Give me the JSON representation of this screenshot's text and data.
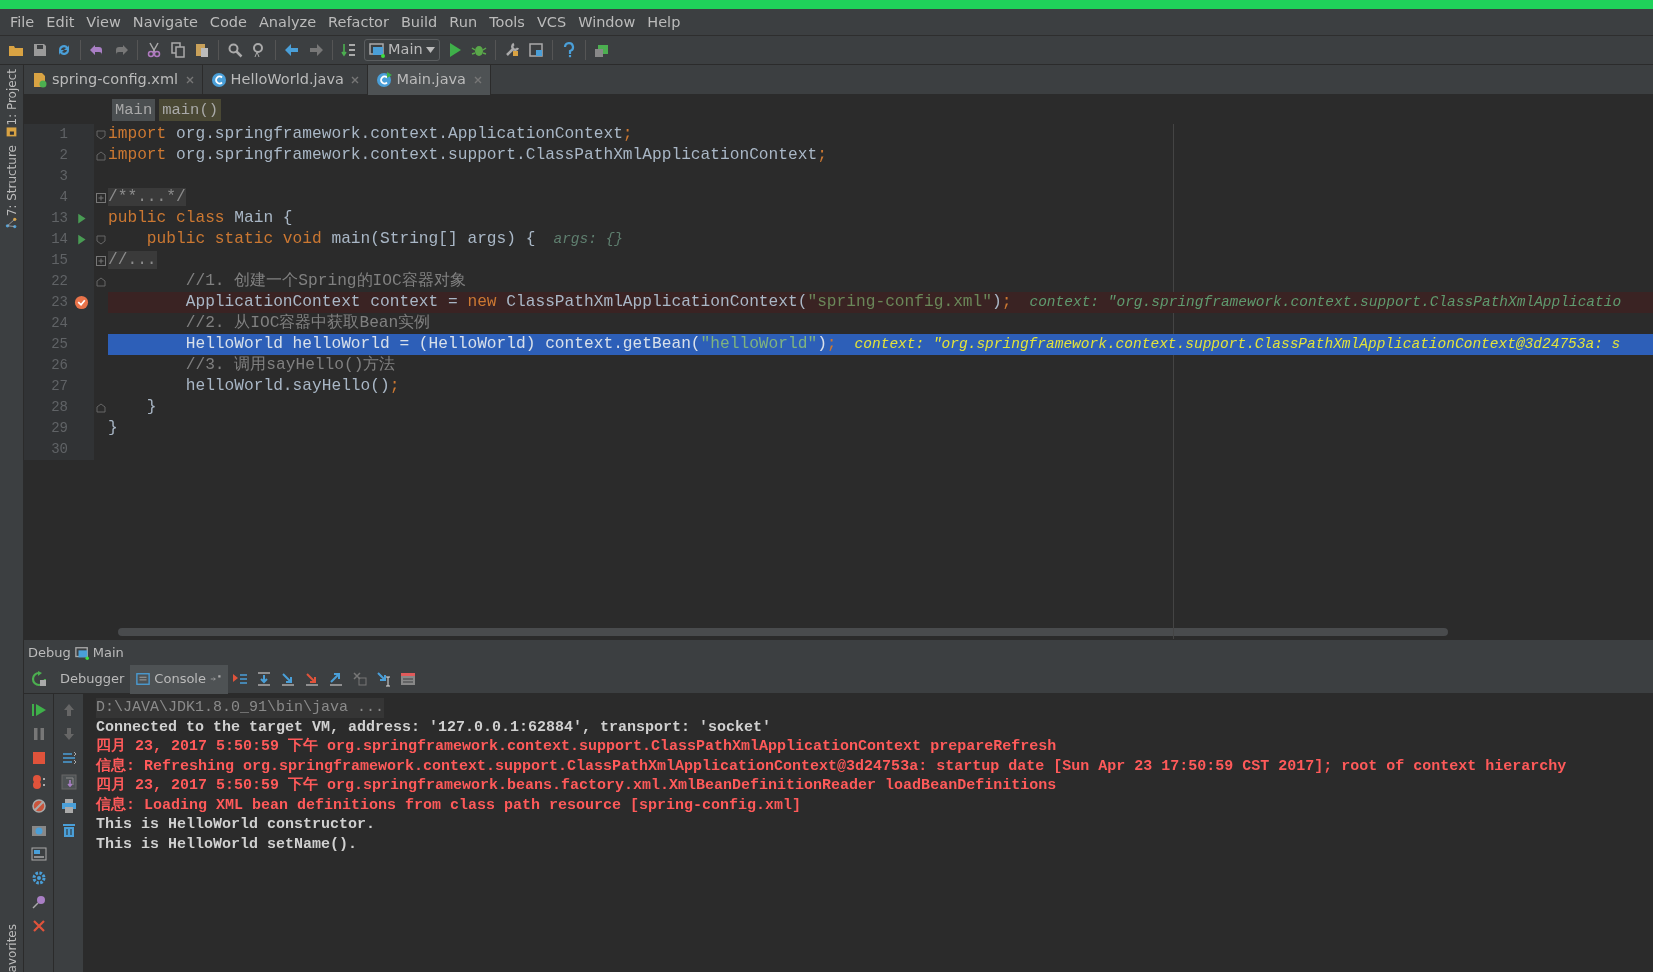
{
  "menu": [
    "File",
    "Edit",
    "View",
    "Navigate",
    "Code",
    "Analyze",
    "Refactor",
    "Build",
    "Run",
    "Tools",
    "VCS",
    "Window",
    "Help"
  ],
  "toolbar": {
    "run_config": "Main"
  },
  "left_strip": {
    "top": [
      "1: Project",
      "7: Structure"
    ],
    "bottom": [
      "avorites"
    ]
  },
  "tabs": [
    {
      "label": "spring-config.xml",
      "kind": "xml",
      "selected": false
    },
    {
      "label": "HelloWorld.java",
      "kind": "class",
      "selected": false
    },
    {
      "label": "Main.java",
      "kind": "main",
      "selected": true
    }
  ],
  "breadcrumbs": [
    "Main",
    "main()"
  ],
  "editor": {
    "lines": [
      {
        "number": "1",
        "runnable": false,
        "breakpoint": false,
        "current": false,
        "fold": {
          "kind": "start"
        },
        "segments": [
          {
            "kind": "keyword",
            "text": "import"
          },
          {
            "kind": "plain",
            "text": " org.springframework.context.ApplicationContext"
          },
          {
            "kind": "keyword",
            "text": ";"
          }
        ]
      },
      {
        "number": "2",
        "runnable": false,
        "breakpoint": false,
        "current": false,
        "fold": {
          "kind": "end"
        },
        "segments": [
          {
            "kind": "keyword",
            "text": "import"
          },
          {
            "kind": "plain",
            "text": " org.springframework.context.support.ClassPathXmlApplicationContext"
          },
          {
            "kind": "keyword",
            "text": ";"
          }
        ]
      },
      {
        "number": "3",
        "runnable": false,
        "breakpoint": false,
        "current": false
      },
      {
        "number": "4",
        "runnable": false,
        "breakpoint": false,
        "current": false,
        "fold": {
          "kind": "collapsed"
        },
        "segments": [
          {
            "kind": "folded",
            "text": "/**...*/"
          }
        ]
      },
      {
        "number": "13",
        "runnable": true,
        "breakpoint": false,
        "current": false,
        "segments": [
          {
            "kind": "keyword",
            "text": "public class"
          },
          {
            "kind": "plain",
            "text": " Main {"
          }
        ]
      },
      {
        "number": "14",
        "runnable": true,
        "breakpoint": false,
        "current": false,
        "fold": {
          "kind": "start"
        },
        "segments": [
          {
            "kind": "keyword",
            "text": "    public static void"
          },
          {
            "kind": "plain",
            "text": " main(String[] args) {"
          },
          {
            "kind": "hint",
            "text": "args: {}"
          }
        ]
      },
      {
        "number": "15",
        "runnable": false,
        "breakpoint": false,
        "current": false,
        "fold": {
          "kind": "collapsed"
        },
        "segments": [
          {
            "kind": "folded",
            "text": "//..."
          }
        ]
      },
      {
        "number": "22",
        "runnable": false,
        "breakpoint": false,
        "current": false,
        "fold": {
          "kind": "end"
        },
        "segments": [
          {
            "kind": "comment",
            "text": "        //1. 创建一个Spring的IOC容器对象"
          }
        ]
      },
      {
        "number": "23",
        "runnable": false,
        "breakpoint": true,
        "current": false,
        "segments": [
          {
            "kind": "plain",
            "text": "        ApplicationContext context = "
          },
          {
            "kind": "keyword",
            "text": "new"
          },
          {
            "kind": "plain",
            "text": " ClassPathXmlApplicationContext("
          },
          {
            "kind": "string",
            "text": "\"spring-config.xml\""
          },
          {
            "kind": "plain",
            "text": ")"
          },
          {
            "kind": "keyword",
            "text": ";"
          },
          {
            "kind": "value",
            "text": "context: \"org.springframework.context.support.ClassPathXmlApplicatio"
          }
        ]
      },
      {
        "number": "24",
        "runnable": false,
        "breakpoint": false,
        "current": false,
        "segments": [
          {
            "kind": "comment",
            "text": "        //2. 从IOC容器中获取Bean实例"
          }
        ]
      },
      {
        "number": "25",
        "runnable": false,
        "breakpoint": false,
        "current": true,
        "segments": [
          {
            "kind": "plain",
            "text": "        HelloWorld helloWorld = (HelloWorld) context.getBean("
          },
          {
            "kind": "string",
            "text": "\"helloWorld\""
          },
          {
            "kind": "plain",
            "text": ")"
          },
          {
            "kind": "keyword",
            "text": ";"
          },
          {
            "kind": "value",
            "text": "context: \"org.springframework.context.support.ClassPathXmlApplicationContext@3d24753a: s"
          }
        ]
      },
      {
        "number": "26",
        "runnable": false,
        "breakpoint": false,
        "current": false,
        "segments": [
          {
            "kind": "comment",
            "text": "        //3. 调用sayHello()方法"
          }
        ]
      },
      {
        "number": "27",
        "runnable": false,
        "breakpoint": false,
        "current": false,
        "segments": [
          {
            "kind": "plain",
            "text": "        helloWorld.sayHello()"
          },
          {
            "kind": "keyword",
            "text": ";"
          }
        ]
      },
      {
        "number": "28",
        "runnable": false,
        "breakpoint": false,
        "current": false,
        "fold": {
          "kind": "end"
        },
        "segments": [
          {
            "kind": "plain",
            "text": "    }"
          }
        ]
      },
      {
        "number": "29",
        "runnable": false,
        "breakpoint": false,
        "current": false,
        "segments": [
          {
            "kind": "plain",
            "text": "}"
          }
        ]
      },
      {
        "number": "30",
        "runnable": false,
        "breakpoint": false,
        "current": false
      }
    ]
  },
  "debug": {
    "title": "Debug",
    "config": "Main",
    "tabs": [
      {
        "label": "Debugger",
        "selected": false
      },
      {
        "label": "Console",
        "selected": true
      }
    ],
    "console": [
      {
        "kind": "command",
        "text": "D:\\JAVA\\JDK1.8.0_91\\bin\\java ..."
      },
      {
        "kind": "output",
        "text": "Connected to the target VM, address: '127.0.0.1:62884', transport: 'socket'"
      },
      {
        "kind": "error",
        "text": "四月 23, 2017 5:50:59 下午 org.springframework.context.support.ClassPathXmlApplicationContext prepareRefresh"
      },
      {
        "kind": "error",
        "text": "信息: Refreshing org.springframework.context.support.ClassPathXmlApplicationContext@3d24753a: startup date [Sun Apr 23 17:50:59 CST 2017]; root of context hierarchy"
      },
      {
        "kind": "error",
        "text": "四月 23, 2017 5:50:59 下午 org.springframework.beans.factory.xml.XmlBeanDefinitionReader loadBeanDefinitions"
      },
      {
        "kind": "error",
        "text": "信息: Loading XML bean definitions from class path resource [spring-config.xml]"
      },
      {
        "kind": "output",
        "text": "This is HelloWorld constructor."
      },
      {
        "kind": "output",
        "text": "This is HelloWorld setName()."
      }
    ]
  }
}
